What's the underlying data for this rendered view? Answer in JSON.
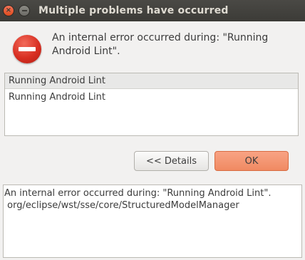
{
  "window": {
    "title": "Multiple problems have occurred",
    "close_glyph": "×",
    "minimize_glyph": ""
  },
  "dialog": {
    "icon": "error-icon",
    "message": "An internal error occurred during: \"Running Android Lint\"."
  },
  "problems": {
    "header": "Running Android Lint",
    "items": [
      "Running Android Lint"
    ]
  },
  "buttons": {
    "details_label": "<< Details",
    "ok_label": "OK"
  },
  "details": {
    "lines": [
      "An internal error occurred during: \"Running Android Lint\".",
      " org/eclipse/wst/sse/core/StructuredModelManager"
    ]
  },
  "colors": {
    "titlebar": "#3c3b37",
    "close_button": "#de4c1f",
    "ok_button": "#f08a62",
    "error_icon": "#d82f22"
  }
}
